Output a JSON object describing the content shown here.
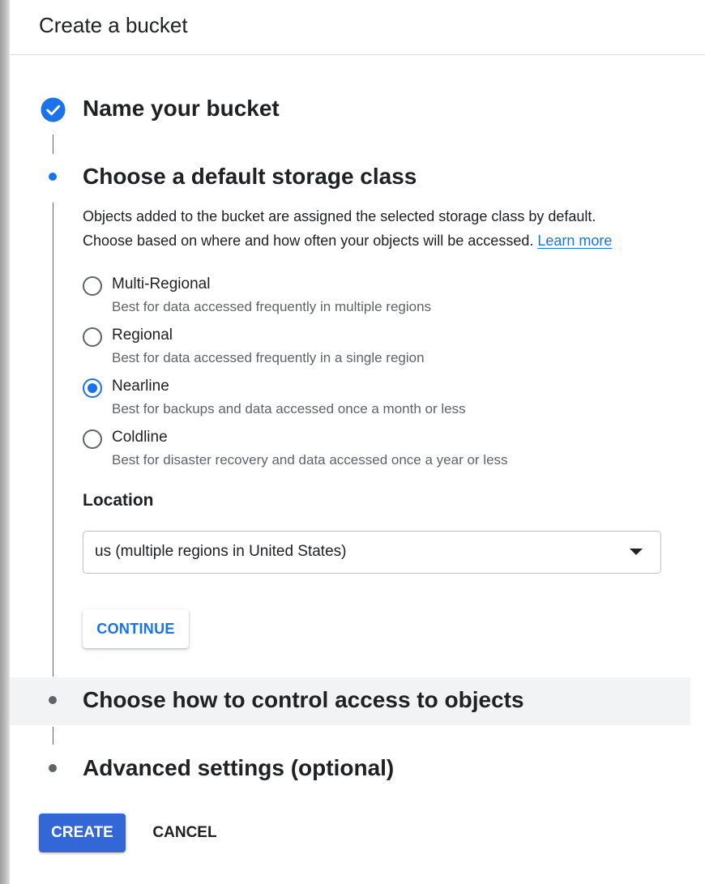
{
  "header": {
    "title": "Create a bucket"
  },
  "steps": [
    {
      "title": "Name your bucket",
      "state": "completed",
      "icon": "check-circle-icon"
    },
    {
      "title": "Choose a default storage class",
      "state": "active",
      "description_line1": "Objects added to the bucket are assigned the selected storage class by default.",
      "description_line2": "Choose based on where and how often your objects will be accessed.",
      "learn_more": "Learn more"
    },
    {
      "title": "Choose how to control access to objects",
      "state": "pending"
    },
    {
      "title": "Advanced settings (optional)",
      "state": "pending"
    }
  ],
  "storage_class": {
    "selected": "Nearline",
    "options": [
      {
        "label": "Multi-Regional",
        "description": "Best for data accessed frequently in multiple regions",
        "checked": false
      },
      {
        "label": "Regional",
        "description": "Best for data accessed frequently in a single region",
        "checked": false
      },
      {
        "label": "Nearline",
        "description": "Best for backups and data accessed once a month or less",
        "checked": true
      },
      {
        "label": "Coldline",
        "description": "Best for disaster recovery and data accessed once a year or less",
        "checked": false
      }
    ]
  },
  "location": {
    "label": "Location",
    "value": "us (multiple regions in United States)"
  },
  "buttons": {
    "continue": "CONTINUE",
    "create": "CREATE",
    "cancel": "CANCEL"
  },
  "colors": {
    "accent": "#1a73e8",
    "primary_button": "#3367d6",
    "hover_row": "#f1f3f4",
    "pending_dot": "#5f6368"
  }
}
